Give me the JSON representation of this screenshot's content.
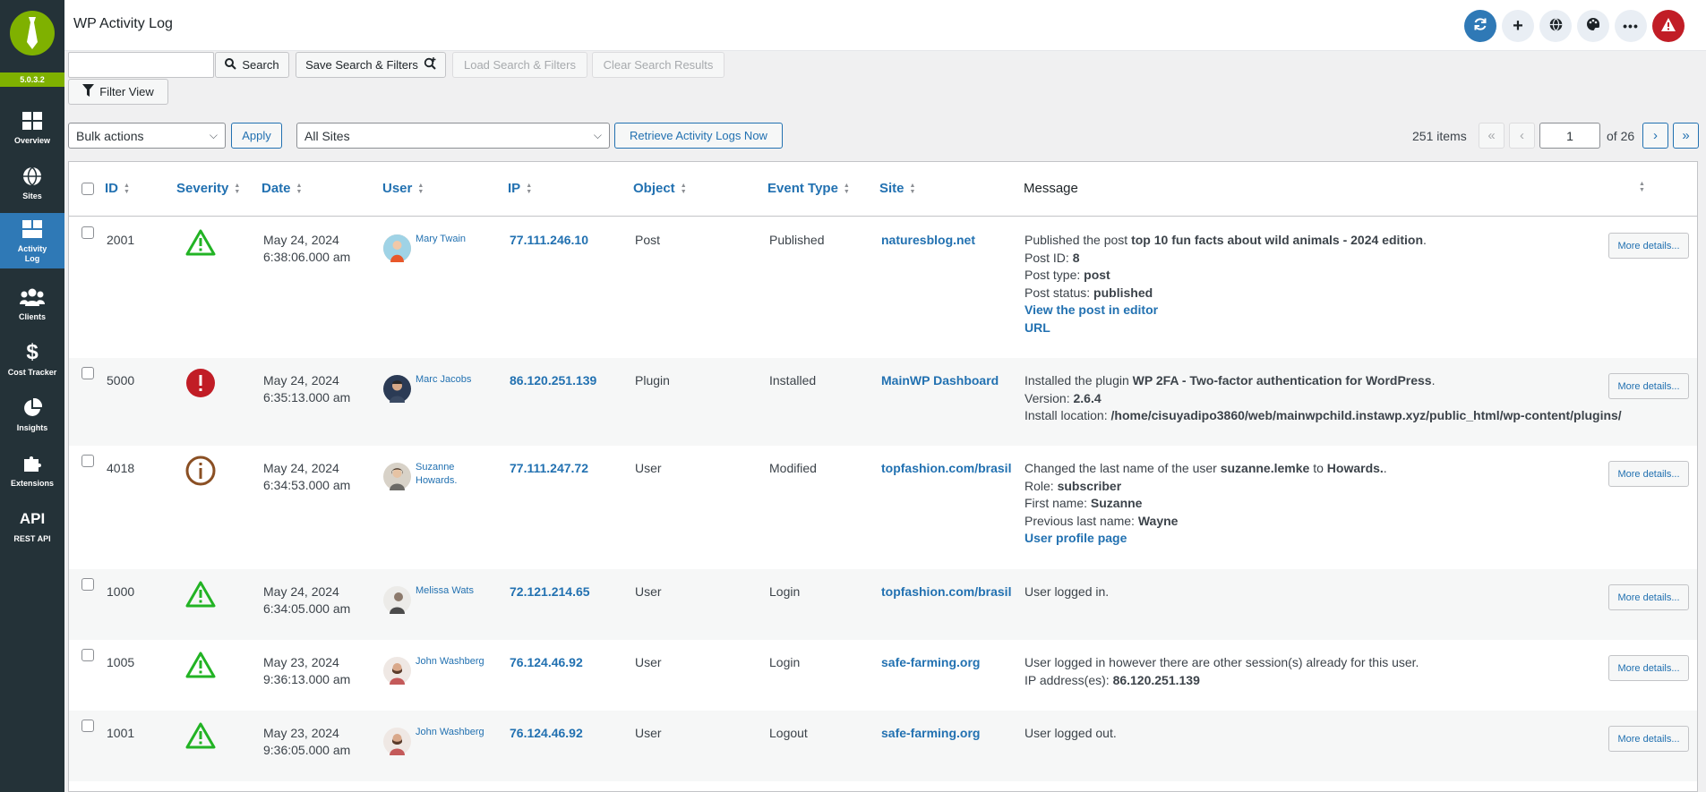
{
  "app": {
    "version": "5.0.3.2",
    "title": "WP Activity Log"
  },
  "sidebar": {
    "items": [
      {
        "label": "Overview",
        "icon": "overview-icon"
      },
      {
        "label": "Sites",
        "icon": "globe-icon"
      },
      {
        "label": "Activity Log",
        "icon": "activity-log-icon",
        "active": true
      },
      {
        "label": "Clients",
        "icon": "users-icon"
      },
      {
        "label": "Cost Tracker",
        "icon": "dollar-icon"
      },
      {
        "label": "Insights",
        "icon": "pie-chart-icon"
      },
      {
        "label": "Extensions",
        "icon": "puzzle-icon"
      },
      {
        "label": "REST API",
        "icon_text": "API"
      }
    ],
    "collapse_icon": "»"
  },
  "toolbar": {
    "search_value": "",
    "search_label": "Search",
    "save_filters_label": "Save Search & Filters",
    "load_filters_label": "Load Search & Filters",
    "clear_results_label": "Clear Search Results",
    "filter_view_label": "Filter View",
    "bulk_actions": "Bulk actions",
    "apply_label": "Apply",
    "sites_select": "All Sites",
    "retrieve_label": "Retrieve Activity Logs Now"
  },
  "pagination": {
    "items": "251 items",
    "current": "1",
    "of": "of 26",
    "first": "«",
    "prev": "‹",
    "next": "›",
    "last": "»"
  },
  "table": {
    "headers": {
      "id": "ID",
      "severity": "Severity",
      "date": "Date",
      "user": "User",
      "ip": "IP",
      "object": "Object",
      "event_type": "Event Type",
      "site": "Site",
      "message": "Message"
    },
    "more_label": "More details...",
    "rows": [
      {
        "id": "2001",
        "severity": "warning",
        "date": "May 24, 2024",
        "time": "6:38:06.000 am",
        "user": "Mary Twain",
        "user2": "",
        "ip": "77.111.246.10",
        "object": "Post",
        "event": "Published",
        "site": "naturesblog.net",
        "m1a": "Published the post ",
        "m1b": "top 10 fun facts about wild animals - 2024 edition",
        "m1c": ".",
        "m2a": "Post ID: ",
        "m2b": "8",
        "m3a": "Post type: ",
        "m3b": "post",
        "m4a": "Post status: ",
        "m4b": "published",
        "l1": "View the post in editor",
        "l2": "URL"
      },
      {
        "id": "5000",
        "severity": "critical",
        "date": "May 24, 2024",
        "time": "6:35:13.000 am",
        "user": "Marc Jacobs",
        "user2": "",
        "ip": "86.120.251.139",
        "object": "Plugin",
        "event": "Installed",
        "site": "MainWP Dashboard",
        "m1a": "Installed the plugin ",
        "m1b": "WP 2FA - Two-factor authentication for WordPress",
        "m1c": ".",
        "m2a": "Version: ",
        "m2b": "2.6.4",
        "m3a": "Install location: ",
        "m3b": "/home/cisuyadipo3860/web/mainwpchild.instawp.xyz/public_html/wp-content/plugins/"
      },
      {
        "id": "4018",
        "severity": "info",
        "date": "May 24, 2024",
        "time": "6:34:53.000 am",
        "user": "Suzanne",
        "user2": "Howards.",
        "ip": "77.111.247.72",
        "object": "User",
        "event": "Modified",
        "site": "topfashion.com/brasil",
        "m1a": "Changed the last name of the user ",
        "m1b": "suzanne.lemke",
        "m1c": " to ",
        "m1d": "Howards.",
        "m1e": ".",
        "m2a": "Role: ",
        "m2b": "subscriber",
        "m3a": "First name: ",
        "m3b": "Suzanne",
        "m4a": "Previous last name: ",
        "m4b": "Wayne",
        "l1": "User profile page"
      },
      {
        "id": "1000",
        "severity": "warning",
        "date": "May 24, 2024",
        "time": "6:34:05.000 am",
        "user": "Melissa Wats",
        "user2": "",
        "ip": "72.121.214.65",
        "object": "User",
        "event": "Login",
        "site": "topfashion.com/brasil",
        "m1a": "User logged in."
      },
      {
        "id": "1005",
        "severity": "warning",
        "date": "May 23, 2024",
        "time": "9:36:13.000 am",
        "user": "John Washberg",
        "user2": "",
        "ip": "76.124.46.92",
        "object": "User",
        "event": "Login",
        "site": "safe-farming.org",
        "m1a": "User logged in however there are other session(s) already for this user.",
        "m2a": "IP address(es): ",
        "m2b": "86.120.251.139"
      },
      {
        "id": "1001",
        "severity": "warning",
        "date": "May 23, 2024",
        "time": "9:36:05.000 am",
        "user": "John Washberg",
        "user2": "",
        "ip": "76.124.46.92",
        "object": "User",
        "event": "Logout",
        "site": "safe-farming.org",
        "m1a": "User logged out."
      }
    ]
  },
  "colors": {
    "sidebar": "#243238",
    "accent_green": "#7fb100",
    "link_blue": "#2271b1",
    "active_blue": "#2f79b6",
    "critical_red": "#c11d26",
    "info_brown": "#8a4f23",
    "warning_green": "#22b324"
  }
}
